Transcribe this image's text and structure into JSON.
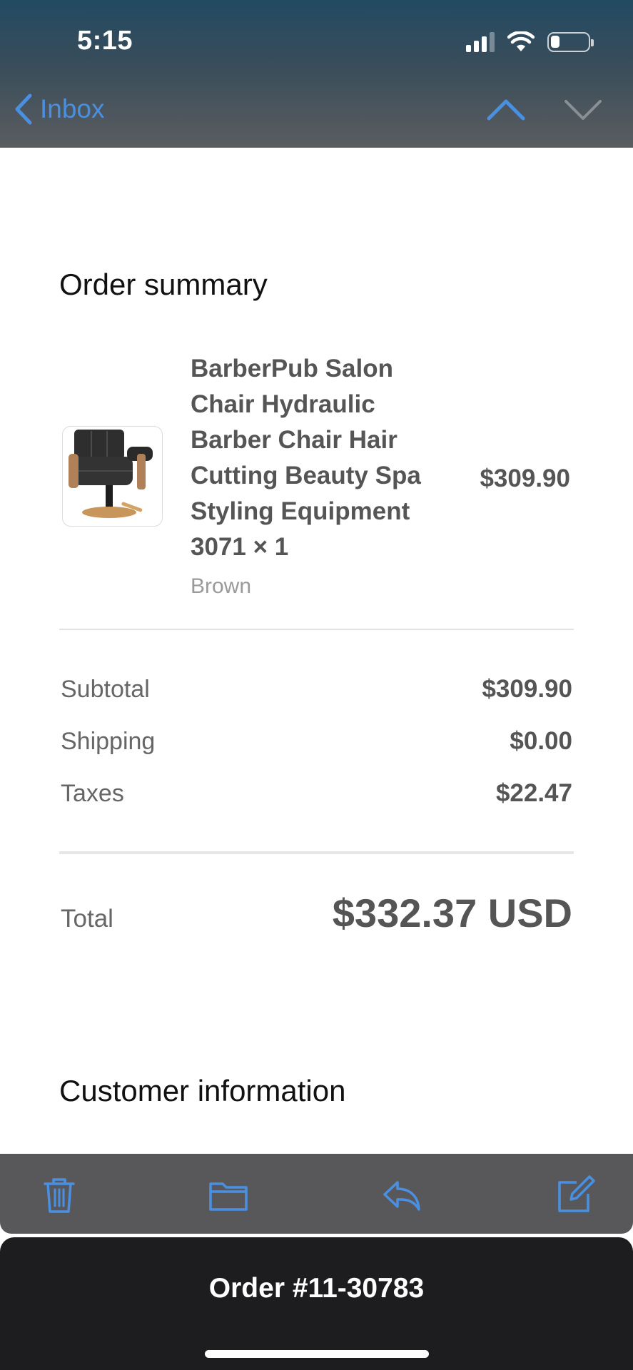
{
  "status_bar": {
    "time": "5:15"
  },
  "nav": {
    "back_label": "Inbox"
  },
  "order_summary": {
    "title": "Order summary",
    "item": {
      "name": "BarberPub Salon Chair Hydraulic Barber Chair Hair Cutting Beauty Spa Styling Equipment 3071 × 1",
      "variant": "Brown",
      "price": "$309.90"
    },
    "subtotal_label": "Subtotal",
    "subtotal_value": "$309.90",
    "shipping_label": "Shipping",
    "shipping_value": "$0.00",
    "taxes_label": "Taxes",
    "taxes_value": "$22.47",
    "total_label": "Total",
    "total_value": "$332.37 USD"
  },
  "customer_info": {
    "title": "Customer information"
  },
  "bottom_sheet": {
    "title": "Order #11-30783"
  },
  "colors": {
    "accent": "#4a90e2",
    "toolbar": "#58585a",
    "sheet": "#1d1d1f"
  },
  "icons": [
    "chevron-left-icon",
    "chevron-up-icon",
    "chevron-down-icon",
    "trash-icon",
    "folder-icon",
    "reply-icon",
    "compose-icon"
  ]
}
